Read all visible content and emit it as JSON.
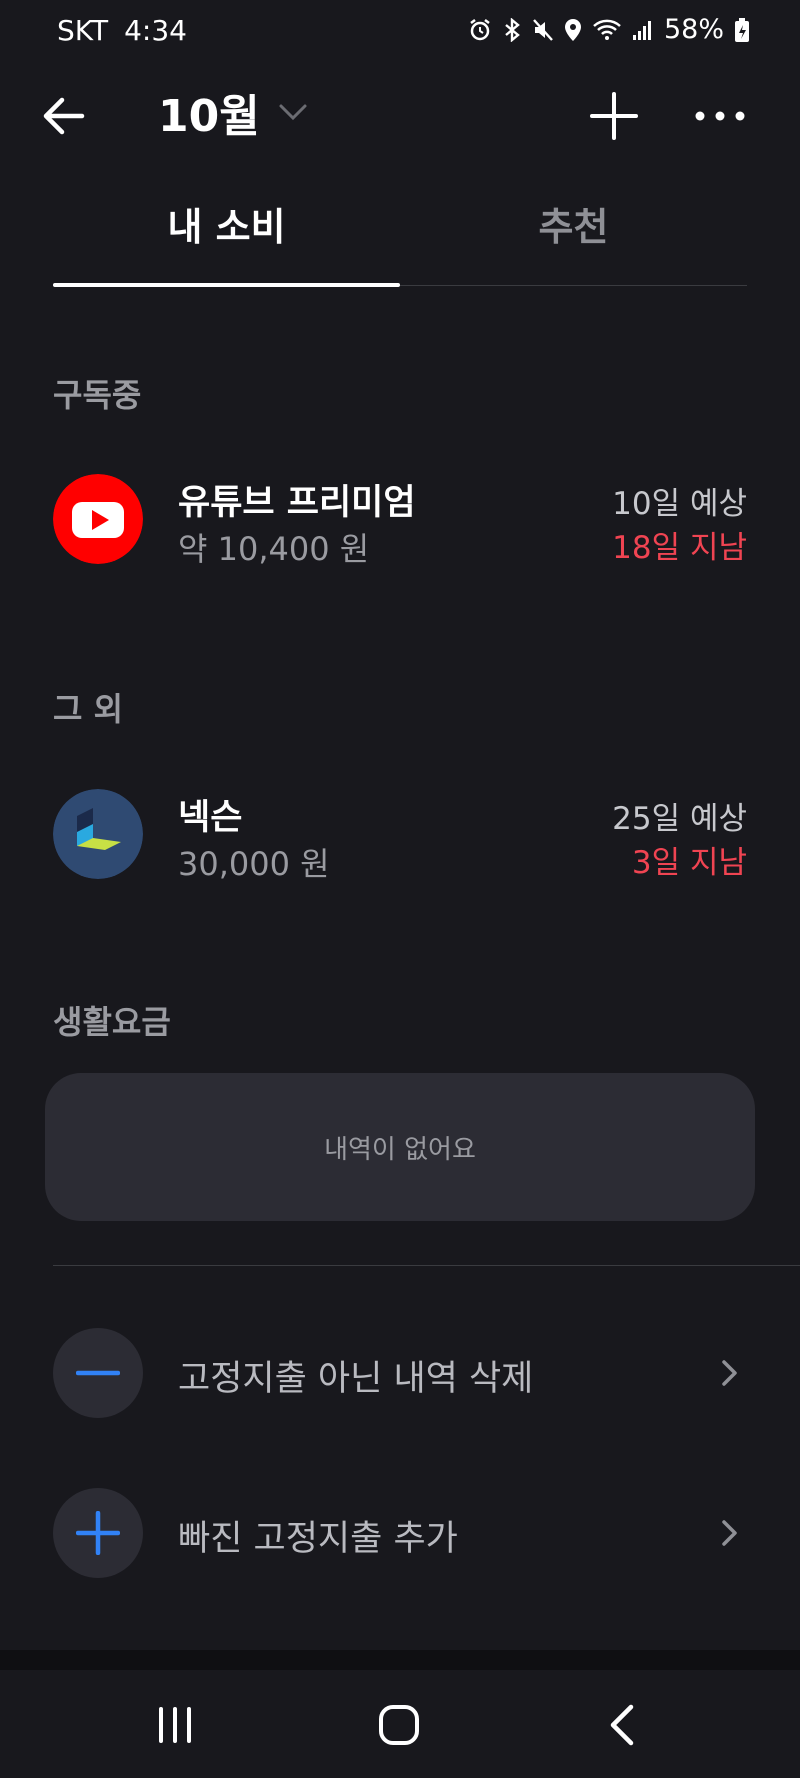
{
  "status_bar": {
    "carrier": "SKT",
    "time": "4:34",
    "battery": "58%"
  },
  "header": {
    "month": "10월"
  },
  "tabs": [
    {
      "label": "내 소비",
      "active": true
    },
    {
      "label": "추천",
      "active": false
    }
  ],
  "sections": {
    "subscribing": {
      "title": "구독중",
      "items": [
        {
          "name": "유튜브 프리미엄",
          "amount": "약 10,400 원",
          "expected": "10일 예상",
          "overdue": "18일 지남",
          "icon": "youtube-icon"
        }
      ]
    },
    "others": {
      "title": "그 외",
      "items": [
        {
          "name": "넥슨",
          "amount": "30,000 원",
          "expected": "25일 예상",
          "overdue": "3일 지남",
          "icon": "nexon-icon"
        }
      ]
    },
    "utilities": {
      "title": "생활요금",
      "empty_text": "내역이 없어요"
    }
  },
  "actions": [
    {
      "label": "고정지출 아닌 내역 삭제",
      "icon": "minus-icon"
    },
    {
      "label": "빠진 고정지출 추가",
      "icon": "plus-icon"
    }
  ],
  "colors": {
    "background": "#18181d",
    "overdue": "#f04452",
    "accent_blue": "#3182f6",
    "card": "#2c2c34"
  }
}
